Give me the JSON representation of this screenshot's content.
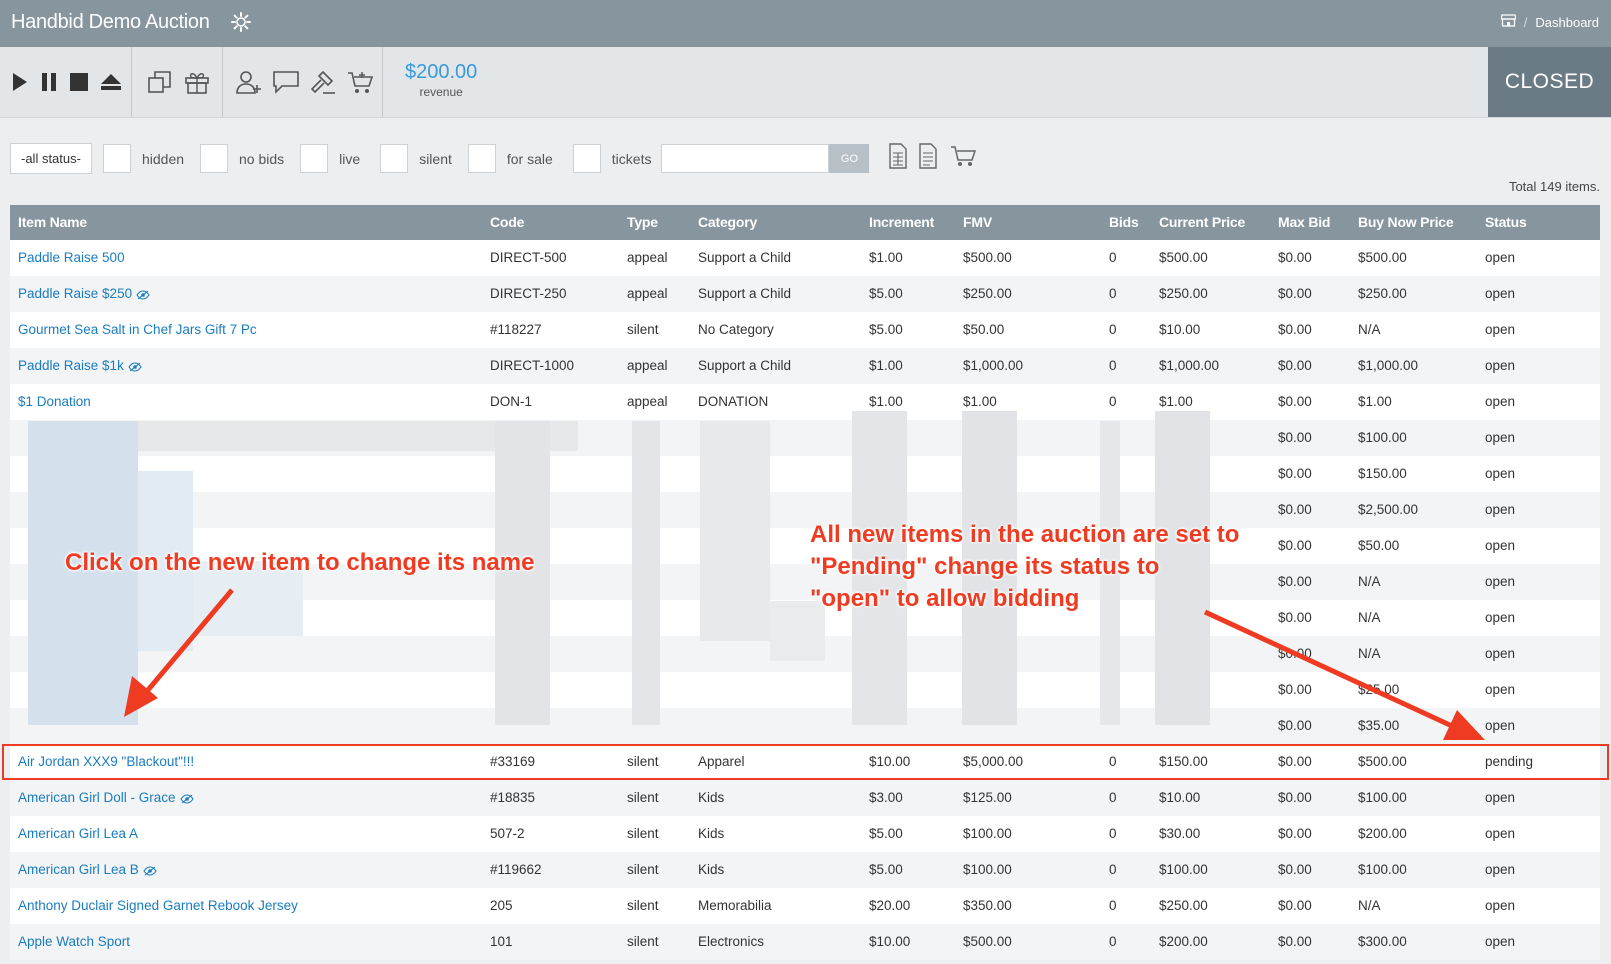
{
  "header": {
    "title": "Handbid Demo Auction",
    "breadcrumb": {
      "separator": "/",
      "current": "Dashboard"
    }
  },
  "toolbar": {
    "revenue_amount": "$200.00",
    "revenue_label": "revenue",
    "auction_status": "CLOSED"
  },
  "filters": {
    "status_select": "-all status-",
    "checkbox_labels": [
      "hidden",
      "no bids",
      "live",
      "silent",
      "for sale",
      "tickets"
    ],
    "go_label": "GO",
    "search_placeholder": ""
  },
  "summary": {
    "total_text": "Total 149 items."
  },
  "table": {
    "columns": [
      "Item Name",
      "Code",
      "Type",
      "Category",
      "Increment",
      "FMV",
      "Bids",
      "Current Price",
      "Max Bid",
      "Buy Now Price",
      "Status"
    ],
    "rows_top": [
      [
        "Paddle Raise 500",
        "DIRECT-500",
        "appeal",
        "Support a Child",
        "$1.00",
        "$500.00",
        "0",
        "$500.00",
        "$0.00",
        "$500.00",
        "open"
      ],
      [
        "Paddle Raise $250",
        "DIRECT-250",
        "appeal",
        "Support a Child",
        "$5.00",
        "$250.00",
        "0",
        "$250.00",
        "$0.00",
        "$250.00",
        "open"
      ],
      [
        "Gourmet Sea Salt in Chef Jars Gift 7 Pc",
        "#118227",
        "silent",
        "No Category",
        "$5.00",
        "$50.00",
        "0",
        "$10.00",
        "$0.00",
        "N/A",
        "open"
      ],
      [
        "Paddle Raise $1k",
        "DIRECT-1000",
        "appeal",
        "Support a Child",
        "$1.00",
        "$1,000.00",
        "0",
        "$1,000.00",
        "$0.00",
        "$1,000.00",
        "open"
      ],
      [
        "$1 Donation",
        "DON-1",
        "appeal",
        "DONATION",
        "$1.00",
        "$1.00",
        "0",
        "$1.00",
        "$0.00",
        "$1.00",
        "open"
      ]
    ],
    "rows_blurred": [
      [
        "$0.00",
        "$100.00",
        "open"
      ],
      [
        "$0.00",
        "$150.00",
        "open"
      ],
      [
        "$0.00",
        "$2,500.00",
        "open"
      ],
      [
        "$0.00",
        "$50.00",
        "open"
      ],
      [
        "$0.00",
        "N/A",
        "open"
      ],
      [
        "$0.00",
        "N/A",
        "open"
      ],
      [
        "$0.00",
        "N/A",
        "open"
      ],
      [
        "$0.00",
        "$25.00",
        "open"
      ],
      [
        "$0.00",
        "$35.00",
        "open"
      ]
    ],
    "rows_bottom": [
      [
        "Air Jordan XXX9 \"Blackout\"!!!",
        "#33169",
        "silent",
        "Apparel",
        "$10.00",
        "$5,000.00",
        "0",
        "$150.00",
        "$0.00",
        "$500.00",
        "pending"
      ],
      [
        "American Girl Doll - Grace",
        "#18835",
        "silent",
        "Kids",
        "$3.00",
        "$125.00",
        "0",
        "$10.00",
        "$0.00",
        "$100.00",
        "open"
      ],
      [
        "American Girl Lea A",
        "507-2",
        "silent",
        "Kids",
        "$5.00",
        "$100.00",
        "0",
        "$30.00",
        "$0.00",
        "$200.00",
        "open"
      ],
      [
        "American Girl Lea B",
        "#119662",
        "silent",
        "Kids",
        "$5.00",
        "$100.00",
        "0",
        "$100.00",
        "$0.00",
        "$100.00",
        "open"
      ],
      [
        "Anthony Duclair Signed Garnet Rebook Jersey",
        "205",
        "silent",
        "Memorabilia",
        "$20.00",
        "$350.00",
        "0",
        "$250.00",
        "$0.00",
        "N/A",
        "open"
      ],
      [
        "Apple Watch Sport",
        "101",
        "silent",
        "Electronics",
        "$10.00",
        "$500.00",
        "0",
        "$200.00",
        "$0.00",
        "$300.00",
        "open"
      ]
    ],
    "hidden_icon_rows": [
      "Paddle Raise $250",
      "Paddle Raise $1k",
      "American Girl Doll - Grace",
      "American Girl Lea B"
    ]
  },
  "annotations": {
    "left_callout": "Click on the new item to change its name",
    "right_callout": [
      "All new items in the auction are set to",
      "\"Pending\" change its status to",
      "\"open\" to allow bidding"
    ]
  },
  "colors": {
    "header_bg": "#87959f",
    "link": "#1a7cc0",
    "revenue": "#3a9ad9",
    "closed_bg": "#6b7b86",
    "annotation": "#ef3b22"
  }
}
